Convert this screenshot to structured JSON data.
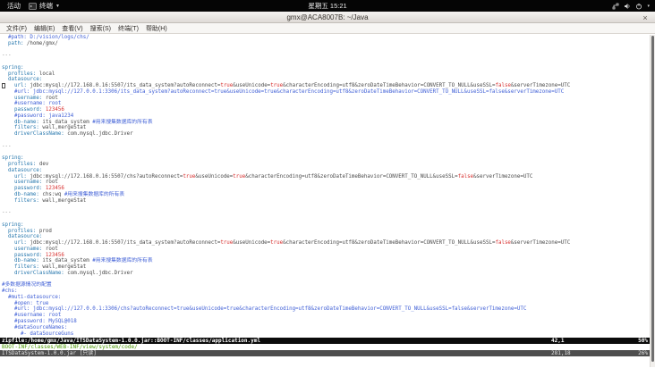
{
  "desktop_bar": {
    "activities": "活动",
    "app_name": "终端",
    "app_caret": "▼",
    "clock": "星期五 15:21"
  },
  "window": {
    "title": "gmx@ACA8007B: ~/Java",
    "close_label": "×"
  },
  "menu_bar": {
    "items": [
      "文件(F)",
      "编辑(E)",
      "查看(V)",
      "搜索(S)",
      "终端(T)",
      "帮助(H)"
    ]
  },
  "colors": {
    "key": "#2878ae",
    "comment": "#3f5fd6",
    "value": "#4a4a4a",
    "literal": "#d8302f",
    "dashes": "#8f8f8f",
    "status_green": "#4e9a06"
  },
  "editor": {
    "lines": [
      [
        [
          "c",
          "  #path: D:/vision/logs/chs/"
        ]
      ],
      [
        [
          "k",
          "  path:"
        ],
        [
          "v",
          " /home/gmx/"
        ]
      ],
      [],
      [
        [
          "d",
          "---"
        ]
      ],
      [],
      [
        [
          "k",
          "spring:"
        ]
      ],
      [
        [
          "k",
          "  profiles:"
        ],
        [
          "v",
          " local"
        ]
      ],
      [
        [
          "k",
          "  datasource:"
        ]
      ],
      [
        [
          "cur",
          " "
        ],
        [
          "k",
          "   url:"
        ],
        [
          "v",
          " jdbc:mysql://172.168.0.16:5507/its_data_system?autoReconnect="
        ],
        [
          "b",
          "true"
        ],
        [
          "v",
          "&useUnicode="
        ],
        [
          "b",
          "true"
        ],
        [
          "v",
          "&characterEncoding=utf8&zeroDateTimeBehavior=CONVERT_TO_NULL&useSSL="
        ],
        [
          "b",
          "false"
        ],
        [
          "v",
          "&serverTimezone=UTC"
        ]
      ],
      [
        [
          "c",
          "    #url: jdbc:mysql://127.0.0.1:3306/its_data_system?autoReconnect=true&useUnicode=true&characterEncoding=utf8&zeroDateTimeBehavior=CONVERT_TO_NULL&useSSL=false&serverTimezone=UTC"
        ]
      ],
      [
        [
          "k",
          "    username:"
        ],
        [
          "v",
          " root"
        ]
      ],
      [
        [
          "c",
          "    #username: root"
        ]
      ],
      [
        [
          "k",
          "    password:"
        ],
        [
          "n",
          " 123456"
        ]
      ],
      [
        [
          "c",
          "    #password: java1234"
        ]
      ],
      [
        [
          "k",
          "    db-name:"
        ],
        [
          "v",
          " its_data_system "
        ],
        [
          "c",
          "#用来搜集数据库的所有表"
        ]
      ],
      [
        [
          "k",
          "    filters:"
        ],
        [
          "v",
          " wall,mergeStat"
        ]
      ],
      [
        [
          "k",
          "    driverClassName:"
        ],
        [
          "v",
          " com.mysql.jdbc.Driver"
        ]
      ],
      [],
      [
        [
          "d",
          "---"
        ]
      ],
      [],
      [
        [
          "k",
          "spring:"
        ]
      ],
      [
        [
          "k",
          "  profiles:"
        ],
        [
          "v",
          " dev"
        ]
      ],
      [
        [
          "k",
          "  datasource:"
        ]
      ],
      [
        [
          "k",
          "    url:"
        ],
        [
          "v",
          " jdbc:mysql://172.168.0.16:5507/chs?autoReconnect="
        ],
        [
          "b",
          "true"
        ],
        [
          "v",
          "&useUnicode="
        ],
        [
          "b",
          "true"
        ],
        [
          "v",
          "&characterEncoding=utf8&zeroDateTimeBehavior=CONVERT_TO_NULL&useSSL="
        ],
        [
          "b",
          "false"
        ],
        [
          "v",
          "&serverTimezone=UTC"
        ]
      ],
      [
        [
          "k",
          "    username:"
        ],
        [
          "v",
          " root"
        ]
      ],
      [
        [
          "k",
          "    password:"
        ],
        [
          "n",
          " 123456"
        ]
      ],
      [
        [
          "k",
          "    db-name:"
        ],
        [
          "v",
          " chs:wq "
        ],
        [
          "c",
          "#用来搜集数据库的所有表"
        ]
      ],
      [
        [
          "k",
          "    filters:"
        ],
        [
          "v",
          " wall,mergeStat"
        ]
      ],
      [],
      [
        [
          "d",
          "---"
        ]
      ],
      [],
      [
        [
          "k",
          "spring:"
        ]
      ],
      [
        [
          "k",
          "  profiles:"
        ],
        [
          "v",
          " prod"
        ]
      ],
      [
        [
          "k",
          "  datasource:"
        ]
      ],
      [
        [
          "k",
          "    url:"
        ],
        [
          "v",
          " jdbc:mysql://172.168.0.16:5507/its_data_system?autoReconnect="
        ],
        [
          "b",
          "true"
        ],
        [
          "v",
          "&useUnicode="
        ],
        [
          "b",
          "true"
        ],
        [
          "v",
          "&characterEncoding=utf8&zeroDateTimeBehavior=CONVERT_TO_NULL&useSSL="
        ],
        [
          "b",
          "false"
        ],
        [
          "v",
          "&serverTimezone=UTC"
        ]
      ],
      [
        [
          "k",
          "    username:"
        ],
        [
          "v",
          " root"
        ]
      ],
      [
        [
          "k",
          "    password:"
        ],
        [
          "n",
          " 123456"
        ]
      ],
      [
        [
          "k",
          "    db-name:"
        ],
        [
          "v",
          " its_data_system "
        ],
        [
          "c",
          "#用来搜集数据库的所有表"
        ]
      ],
      [
        [
          "k",
          "    filters:"
        ],
        [
          "v",
          " wall,mergeStat"
        ]
      ],
      [
        [
          "k",
          "    driverClassName:"
        ],
        [
          "v",
          " com.mysql.jdbc.Driver"
        ]
      ],
      [],
      [
        [
          "c",
          "#多数据源情况的配置"
        ]
      ],
      [
        [
          "c",
          "#chs:"
        ]
      ],
      [
        [
          "c",
          "  #muti-datasource:"
        ]
      ],
      [
        [
          "c",
          "    #open: true"
        ]
      ],
      [
        [
          "c",
          "    #url: jdbc:mysql://127.0.0.1:3306/chs?autoReconnect=true&useUnicode=true&characterEncoding=utf8&zeroDateTimeBehavior=CONVERT_TO_NULL&useSSL=false&serverTimezone=UTC"
        ]
      ],
      [
        [
          "c",
          "    #username: root"
        ]
      ],
      [
        [
          "c",
          "    #password: MySQL@018"
        ]
      ],
      [
        [
          "c",
          "    #dataSourceNames:"
        ]
      ],
      [
        [
          "c",
          "      #- dataSourceGuns"
        ]
      ]
    ],
    "status_active": {
      "file": "zipfile:/home/gmx/Java/ITSDataSystem-1.0.0.jar::BOOT-INF/classes/application.yml",
      "position": "42,1",
      "progress": "50%"
    },
    "dir_line": {
      "path": "BOOT-INF/classes/WEB-INF/view/system/code/"
    },
    "status_inactive": {
      "file": "ITSDataSystem-1.0.0.jar [只读]",
      "position": "281,18",
      "progress": "26%"
    }
  }
}
